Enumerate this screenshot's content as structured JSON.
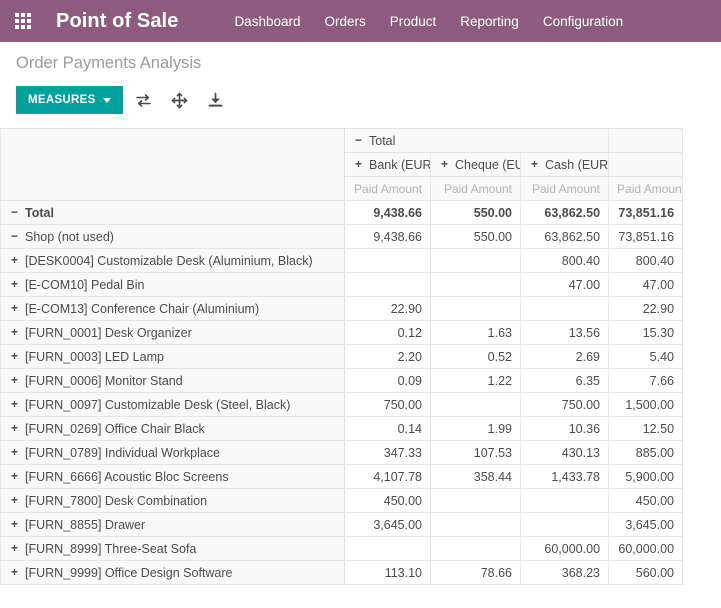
{
  "navbar": {
    "apps_icon": "apps-grid-icon",
    "brand": "Point of Sale",
    "menu": [
      {
        "label": "Dashboard"
      },
      {
        "label": "Orders"
      },
      {
        "label": "Product"
      },
      {
        "label": "Reporting"
      },
      {
        "label": "Configuration"
      }
    ]
  },
  "control_panel": {
    "title": "Order Payments Analysis",
    "measures_label": "MEASURES",
    "tools": [
      {
        "name": "flip-axis-icon",
        "title": "Flip axis"
      },
      {
        "name": "expand-all-icon",
        "title": "Expand all"
      },
      {
        "name": "download-xlsx-icon",
        "title": "Download xlsx"
      }
    ]
  },
  "colors": {
    "navbar_bg": "#8d5b80",
    "accent": "#00a09d",
    "header_cell_bg": "#f9f9f9",
    "border": "#e7e7e7",
    "text": "#4c4c4c",
    "muted_text": "#b3b3b3"
  },
  "pivot": {
    "col_root": {
      "label": "Total",
      "toggle": "−"
    },
    "col_groups": [
      {
        "label": "Bank (EUR)",
        "toggle": "+"
      },
      {
        "label": "Cheque (EUR)",
        "toggle": "+"
      },
      {
        "label": "Cash (EUR)",
        "toggle": "+"
      }
    ],
    "measure_label": "Paid Amount",
    "measure_headers": [
      "Paid Amount",
      "Paid Amount",
      "Paid Amount",
      "Paid Amount"
    ],
    "rows": [
      {
        "label": "Total",
        "toggle": "−",
        "indent": 0,
        "total": true,
        "values": [
          "9,438.66",
          "550.00",
          "63,862.50",
          "73,851.16"
        ]
      },
      {
        "label": "Shop (not used)",
        "toggle": "−",
        "indent": 1,
        "total": false,
        "values": [
          "9,438.66",
          "550.00",
          "63,862.50",
          "73,851.16"
        ]
      },
      {
        "label": "[DESK0004] Customizable Desk (Aluminium, Black)",
        "toggle": "+",
        "indent": 2,
        "total": false,
        "values": [
          "",
          "",
          "800.40",
          "800.40"
        ]
      },
      {
        "label": "[E-COM10] Pedal Bin",
        "toggle": "+",
        "indent": 2,
        "total": false,
        "values": [
          "",
          "",
          "47.00",
          "47.00"
        ]
      },
      {
        "label": "[E-COM13] Conference Chair (Aluminium)",
        "toggle": "+",
        "indent": 2,
        "total": false,
        "values": [
          "22.90",
          "",
          "",
          "22.90"
        ]
      },
      {
        "label": "[FURN_0001] Desk Organizer",
        "toggle": "+",
        "indent": 2,
        "total": false,
        "values": [
          "0.12",
          "1.63",
          "13.56",
          "15.30"
        ]
      },
      {
        "label": "[FURN_0003] LED Lamp",
        "toggle": "+",
        "indent": 2,
        "total": false,
        "values": [
          "2.20",
          "0.52",
          "2.69",
          "5.40"
        ]
      },
      {
        "label": "[FURN_0006] Monitor Stand",
        "toggle": "+",
        "indent": 2,
        "total": false,
        "values": [
          "0.09",
          "1.22",
          "6.35",
          "7.66"
        ]
      },
      {
        "label": "[FURN_0097] Customizable Desk (Steel, Black)",
        "toggle": "+",
        "indent": 2,
        "total": false,
        "values": [
          "750.00",
          "",
          "750.00",
          "1,500.00"
        ]
      },
      {
        "label": "[FURN_0269] Office Chair Black",
        "toggle": "+",
        "indent": 2,
        "total": false,
        "values": [
          "0.14",
          "1.99",
          "10.36",
          "12.50"
        ]
      },
      {
        "label": "[FURN_0789] Individual Workplace",
        "toggle": "+",
        "indent": 2,
        "total": false,
        "values": [
          "347.33",
          "107.53",
          "430.13",
          "885.00"
        ]
      },
      {
        "label": "[FURN_6666] Acoustic Bloc Screens",
        "toggle": "+",
        "indent": 2,
        "total": false,
        "values": [
          "4,107.78",
          "358.44",
          "1,433.78",
          "5,900.00"
        ]
      },
      {
        "label": "[FURN_7800] Desk Combination",
        "toggle": "+",
        "indent": 2,
        "total": false,
        "values": [
          "450.00",
          "",
          "",
          "450.00"
        ]
      },
      {
        "label": "[FURN_8855] Drawer",
        "toggle": "+",
        "indent": 2,
        "total": false,
        "values": [
          "3,645.00",
          "",
          "",
          "3,645.00"
        ]
      },
      {
        "label": "[FURN_8999] Three-Seat Sofa",
        "toggle": "+",
        "indent": 2,
        "total": false,
        "values": [
          "",
          "",
          "60,000.00",
          "60,000.00"
        ]
      },
      {
        "label": "[FURN_9999] Office Design Software",
        "toggle": "+",
        "indent": 2,
        "total": false,
        "values": [
          "113.10",
          "78.66",
          "368.23",
          "560.00"
        ]
      }
    ]
  }
}
